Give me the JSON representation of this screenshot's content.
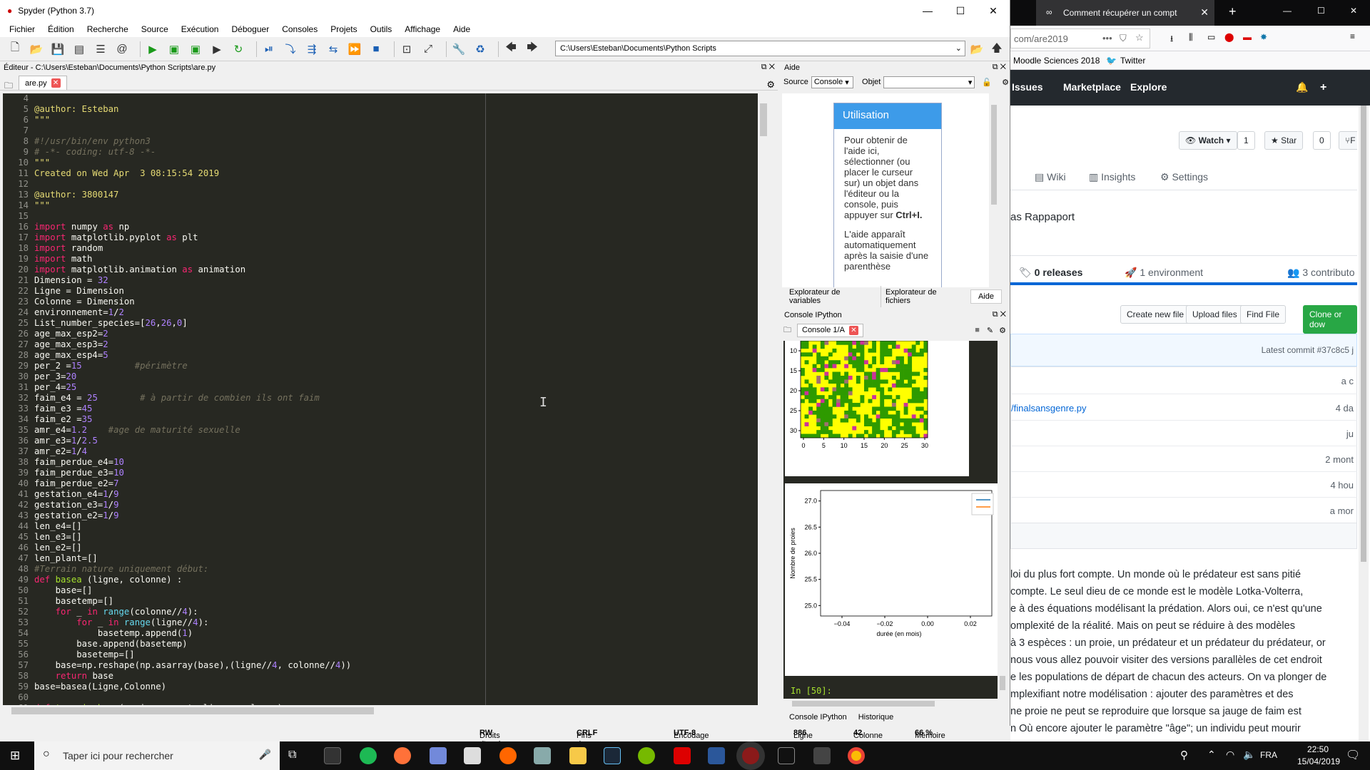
{
  "spyder": {
    "title": "Spyder (Python 3.7)",
    "menu": [
      "Fichier",
      "Édition",
      "Recherche",
      "Source",
      "Exécution",
      "Déboguer",
      "Consoles",
      "Projets",
      "Outils",
      "Affichage",
      "Aide"
    ],
    "path": "C:\\Users\\Esteban\\Documents\\Python Scripts",
    "editor_title": "Éditeur - C:\\Users\\Esteban\\Documents\\Python Scripts\\are.py",
    "tab_label": "are.py",
    "line_start": 4,
    "status": {
      "rights_label": "Droits d'accès :",
      "rights": "RW",
      "eol_label": "Fins de ligne :",
      "eol": "CRLF",
      "enc_label": "Encodage :",
      "enc": "UTF-8",
      "line_label": "Ligne :",
      "line": "886",
      "col_label": "Colonne :",
      "col": "42",
      "mem_label": "Mémoire :",
      "mem": "66 %"
    }
  },
  "help": {
    "title": "Aide",
    "source_label": "Source",
    "source_value": "Console",
    "object_label": "Objet",
    "card_title": "Utilisation",
    "card_p1": "Pour obtenir de l'aide ici, sélectionner (ou placer le curseur sur) un objet dans l'éditeur ou la console, puis appuyer sur",
    "card_p1_key": "Ctrl+I.",
    "card_p2": "L'aide apparaît automatiquement après la saisie d'une parenthèse",
    "tabs": [
      "Explorateur de variables",
      "Explorateur de fichiers",
      "Aide"
    ]
  },
  "console": {
    "title": "Console IPython",
    "tab_label": "Console 1/A",
    "prompt": "In [50]:",
    "bottom_tabs": [
      "Console IPython",
      "Historique"
    ]
  },
  "chart_data": [
    {
      "type": "heatmap",
      "x_ticks": [
        "0",
        "5",
        "10",
        "15",
        "20",
        "25",
        "30"
      ],
      "y_ticks": [
        "10",
        "15",
        "20",
        "25",
        "30"
      ],
      "colors": {
        "land": "#ffff00",
        "grass": "#2e9a00",
        "species_a": "#cc3399",
        "species_b": "#a07070"
      }
    },
    {
      "type": "line",
      "xlabel": "durée (en mois)",
      "ylabel": "Nombre de proies",
      "x_ticks": [
        "−0.04",
        "−0.02",
        "0.00",
        "0.02"
      ],
      "y_ticks": [
        "25.0",
        "25.5",
        "26.0",
        "26.5",
        "27.0"
      ],
      "xlim": [
        -0.05,
        0.03
      ],
      "ylim": [
        24.8,
        27.2
      ],
      "legend_colors": [
        "#1f77b4",
        "#ff7f0e"
      ],
      "legend": "top-right"
    }
  ],
  "firefox": {
    "tab_title": "Comment récupérer un compt",
    "url": "com/are2019",
    "bookmarks": [
      "Moodle Sciences 2018",
      "Twitter"
    ],
    "github_nav": [
      "Issues",
      "Marketplace",
      "Explore"
    ],
    "watch": "Watch",
    "watch_count": "1",
    "star": "Star",
    "star_count": "0",
    "fork": "F",
    "repo_tabs": [
      "Wiki",
      "Insights",
      "Settings"
    ],
    "author": "as Rappaport",
    "releases": "0 releases",
    "environment": "1 environment",
    "contributors": "3 contributo",
    "buttons": [
      "Create new file",
      "Upload files",
      "Find File",
      "Clone or dow"
    ],
    "latest_commit": "Latest commit #37c8c5 j",
    "file_row": "/finalsansgenre.py",
    "times": [
      "a c",
      "4 da",
      "ju",
      "2 mont",
      "4 hou",
      "a mor"
    ],
    "readme": [
      "loi du plus fort compte. Un monde où le prédateur est sans pitié",
      "compte. Le seul dieu de ce monde est le modèle Lotka-Volterra,",
      "e à des équations modélisant la prédation. Alors oui, ce n'est qu'une",
      "omplexité de la réalité. Mais on peut se réduire à des modèles",
      "à 3 espèces : un proie, un prédateur et un prédateur du prédateur, or",
      "nous vous allez pouvoir visiter des versions parallèles de cet endroit",
      "e les populations de départ de chacun des acteurs. On va plonger de",
      "mplexifiant notre modélisation : ajouter des paramètres et des",
      "ne proie ne peut se reproduire que lorsque sa jauge de faim est",
      "n Où encore ajouter le paramètre \"âge\"; un individu peut mourir"
    ]
  },
  "taskbar": {
    "search_placeholder": "Taper ici pour rechercher",
    "lang": "FRA",
    "time": "22:50",
    "date": "15/04/2019"
  }
}
